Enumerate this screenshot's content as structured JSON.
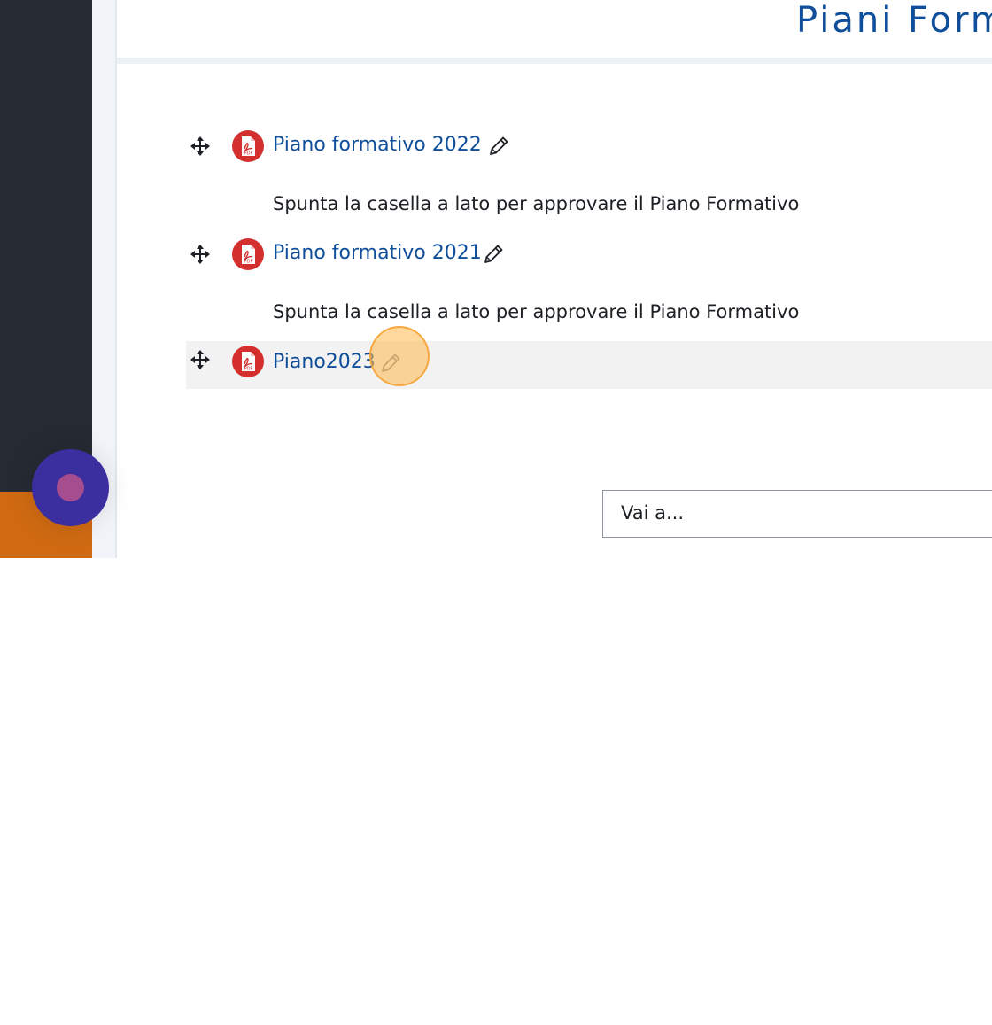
{
  "page_title": "Piani Form",
  "activities": [
    {
      "name": "Piano formativo 2022",
      "file_icon": "pdf-icon",
      "description": "Spunta la casella a lato per approvare il Piano Formativo"
    },
    {
      "name": "Piano formativo 2021",
      "file_icon": "pdf-icon",
      "description": "Spunta la casella a lato per approvare il Piano Formativo"
    },
    {
      "name": "Piano2023",
      "file_icon": "pdf-icon",
      "description": ""
    }
  ],
  "jump_to": {
    "label": "Vai a..."
  },
  "colors": {
    "sidebar": "#262a33",
    "accessibility_bar": "#cf6a12",
    "link": "#0f4e9a",
    "pdf_red": "#d32f2f",
    "highlight_row": "#f2f2f2",
    "fab": "#3b2f9f"
  }
}
